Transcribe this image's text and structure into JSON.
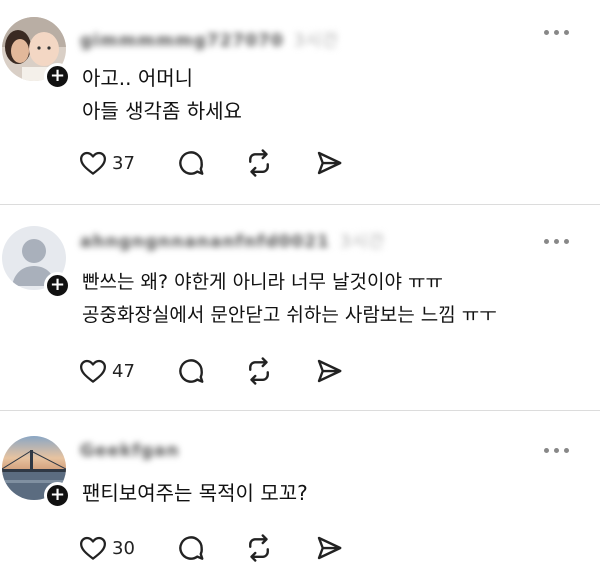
{
  "posts": [
    {
      "username": "gimmmmmg727070",
      "timestamp": "3시간",
      "lines": [
        "아고.. 어머니",
        "아들 생각좀 하세요"
      ],
      "likes": "37",
      "avatar": "photo-avatar-mother-baby"
    },
    {
      "username": "ahngngnnananfnfd0021",
      "timestamp": "3시간",
      "lines": [
        "빤쓰는 왜? 야한게 아니라 너무 날것이야 ㅠㅠ",
        "공중화장실에서 문안닫고 쉬하는 사람보는 느낌 ㅠㅜ"
      ],
      "likes": "47",
      "avatar": "default-avatar"
    },
    {
      "username": "Geekfgan",
      "timestamp": "3시간",
      "lines": [
        "팬티보여주는 목적이 모꼬?"
      ],
      "likes": "30",
      "avatar": "photo-avatar-sunset-bridge"
    }
  ],
  "icons": {
    "like": "heart-icon",
    "reply": "comment-icon",
    "repost": "repost-icon",
    "share": "send-icon",
    "more": "more-options-icon",
    "follow": "plus-icon"
  }
}
